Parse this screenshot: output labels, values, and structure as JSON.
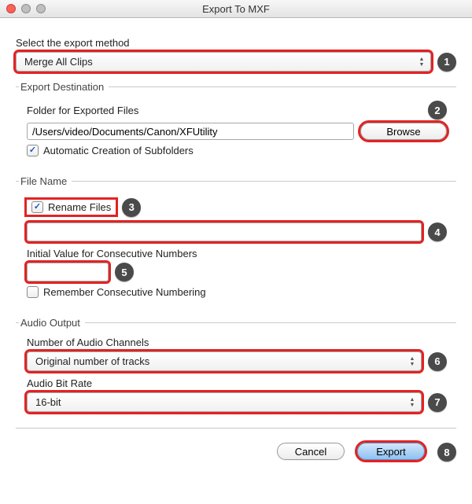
{
  "window": {
    "title": "Export To MXF"
  },
  "method": {
    "label": "Select the export method",
    "value": "Merge All Clips"
  },
  "destination": {
    "legend": "Export Destination",
    "folder_label": "Folder for Exported Files",
    "folder_value": "/Users/video/Documents/Canon/XFUtility",
    "browse": "Browse",
    "auto_subfolders": "Automatic Creation of Subfolders",
    "auto_subfolders_checked": true
  },
  "filename": {
    "legend": "File Name",
    "rename": "Rename Files",
    "rename_checked": true,
    "name_value": "",
    "initial_label": "Initial Value for Consecutive Numbers",
    "initial_value": "",
    "remember": "Remember Consecutive Numbering",
    "remember_checked": false
  },
  "audio": {
    "legend": "Audio Output",
    "channels_label": "Number of Audio Channels",
    "channels_value": "Original number of tracks",
    "bitrate_label": "Audio Bit Rate",
    "bitrate_value": "16-bit"
  },
  "buttons": {
    "cancel": "Cancel",
    "export": "Export"
  },
  "annotations": {
    "n1": "1",
    "n2": "2",
    "n3": "3",
    "n4": "4",
    "n5": "5",
    "n6": "6",
    "n7": "7",
    "n8": "8"
  }
}
